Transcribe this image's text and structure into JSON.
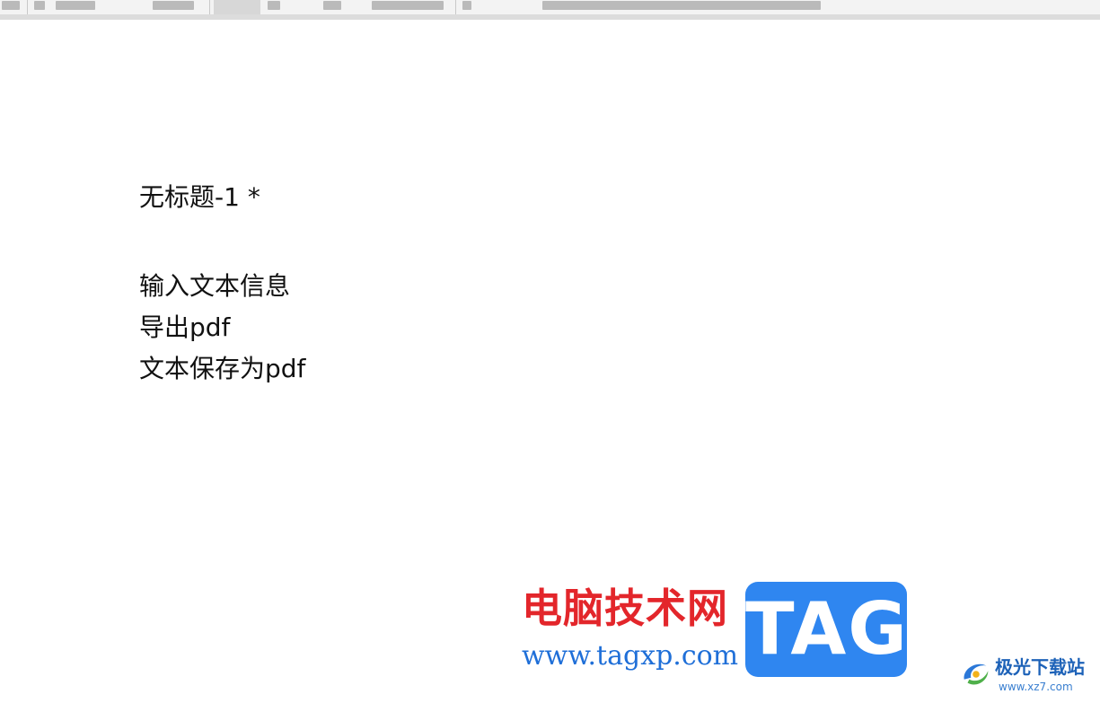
{
  "document": {
    "title": "无标题-1 *",
    "lines": [
      "输入文本信息",
      "导出pdf",
      "文本保存为pdf"
    ]
  },
  "watermark": {
    "cn_text": "电脑技术网",
    "url": "www.tagxp.com",
    "tag": "TAG"
  },
  "site_logo": {
    "name": "极光下载站",
    "url": "www.xz7.com"
  },
  "colors": {
    "watermark_red": "#e3262b",
    "watermark_blue": "#1f6fd8",
    "tag_bg": "#2f86f0",
    "site_blue": "#1d62b8"
  }
}
